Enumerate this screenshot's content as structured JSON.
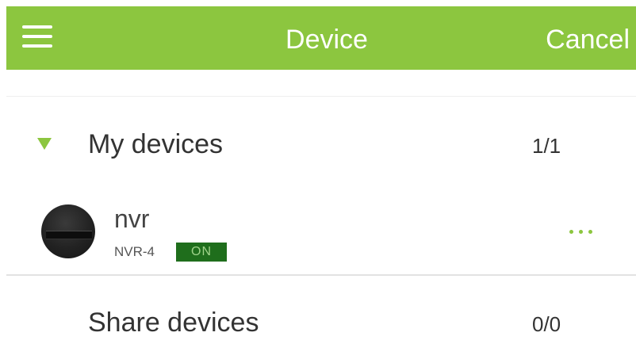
{
  "header": {
    "title": "Device",
    "cancel_label": "Cancel",
    "menu_icon": "hamburger-menu-icon",
    "background_color": "#8cc63f"
  },
  "groups": [
    {
      "label": "My devices",
      "count": "1/1",
      "expanded": true
    },
    {
      "label": "Share devices",
      "count": "0/0",
      "expanded": false
    }
  ],
  "devices": [
    {
      "name": "nvr",
      "model": "NVR-4",
      "status": "ON",
      "status_color": "#1f6e1c",
      "more_icon": "more-dots-icon"
    }
  ],
  "colors": {
    "accent": "#8cc63f",
    "text": "#333333"
  }
}
